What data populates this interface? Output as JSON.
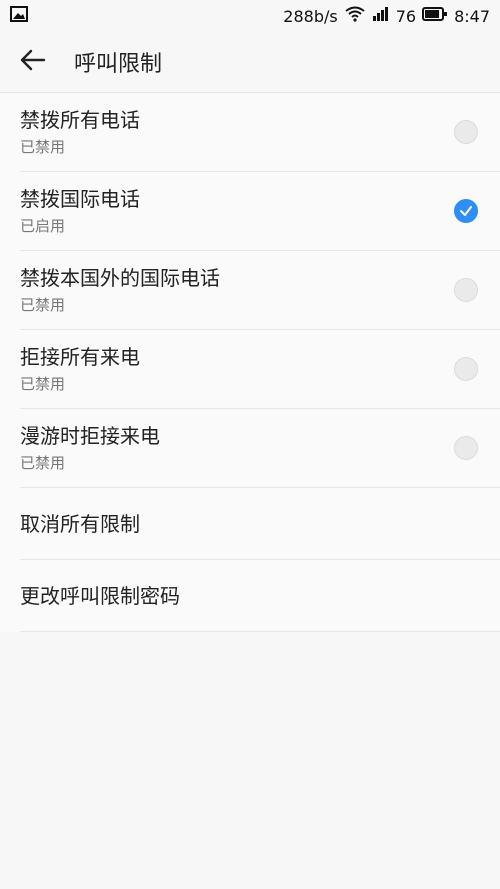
{
  "status_bar": {
    "network_speed": "288b/s",
    "battery_level": "76",
    "time": "8:47",
    "icons": [
      "image-icon",
      "wifi-icon",
      "signal-icon",
      "battery-icon"
    ]
  },
  "app_bar": {
    "title": "呼叫限制",
    "back_icon": "arrow-left-icon"
  },
  "items": [
    {
      "title": "禁拨所有电话",
      "subtitle": "已禁用",
      "checked": false
    },
    {
      "title": "禁拨国际电话",
      "subtitle": "已启用",
      "checked": true
    },
    {
      "title": "禁拨本国外的国际电话",
      "subtitle": "已禁用",
      "checked": false
    },
    {
      "title": "拒接所有来电",
      "subtitle": "已禁用",
      "checked": false
    },
    {
      "title": "漫游时拒接来电",
      "subtitle": "已禁用",
      "checked": false
    }
  ],
  "actions": [
    {
      "title": "取消所有限制"
    },
    {
      "title": "更改呼叫限制密码"
    }
  ],
  "colors": {
    "accent": "#2f8ef3",
    "background": "#f7f7f7",
    "divider": "#e6e6e6"
  }
}
